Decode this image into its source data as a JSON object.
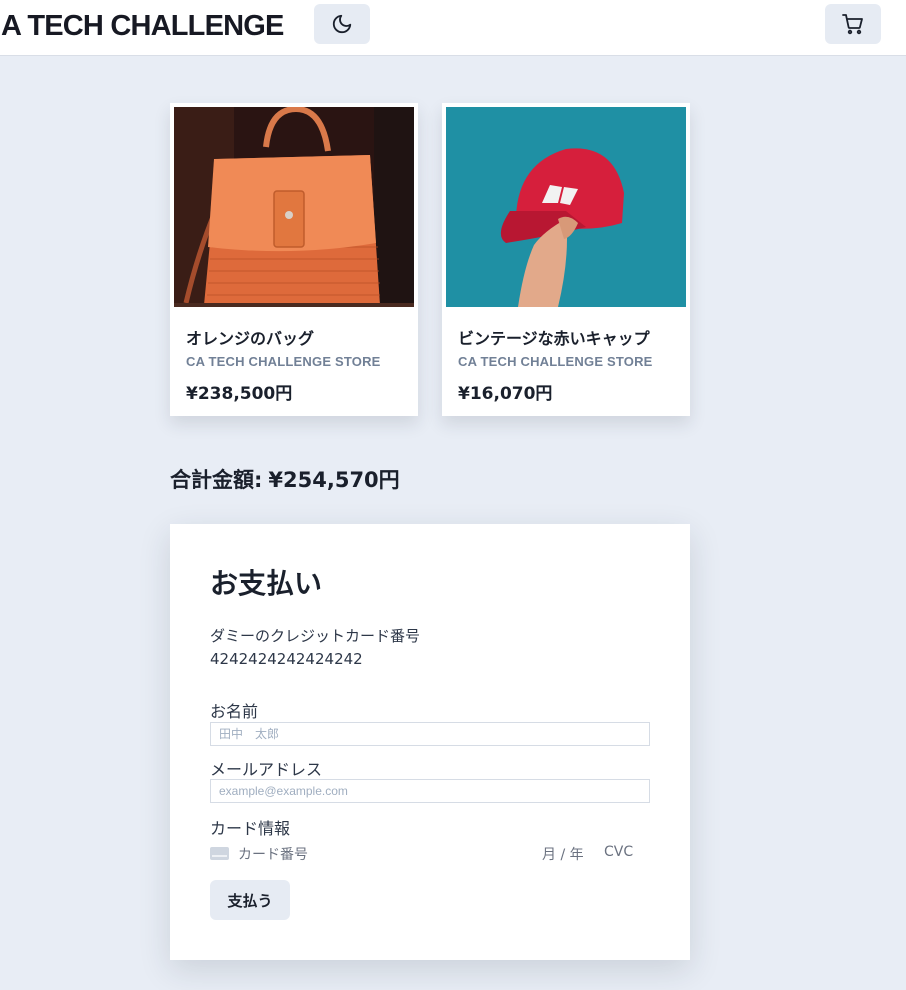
{
  "header": {
    "brand": "A TECH CHALLENGE",
    "theme_toggle_icon": "moon-icon",
    "cart_icon": "cart-icon"
  },
  "products": [
    {
      "name": "オレンジのバッグ",
      "store": "CA TECH CHALLENGE STORE",
      "price": "¥238,500円",
      "image_icon": "orange-bag-image"
    },
    {
      "name": "ビンテージな赤いキャップ",
      "store": "CA TECH CHALLENGE STORE",
      "price": "¥16,070円",
      "image_icon": "red-cap-image"
    }
  ],
  "total": {
    "label": "合計金額:",
    "value": "¥254,570円"
  },
  "payment": {
    "title": "お支払い",
    "dummy_card_label": "ダミーのクレジットカード番号",
    "dummy_card_number": "4242424242424242",
    "name_label": "お名前",
    "name_placeholder": "田中　太郎",
    "email_label": "メールアドレス",
    "email_placeholder": "example@example.com",
    "card_label": "カード情報",
    "card_number_placeholder": "カード番号",
    "expiry_placeholder": "月 / 年",
    "cvc_placeholder": "CVC",
    "submit_label": "支払う"
  },
  "colors": {
    "background": "#e8edf5",
    "surface": "#ffffff",
    "button": "#e6ebf3",
    "muted_text": "#718096"
  }
}
